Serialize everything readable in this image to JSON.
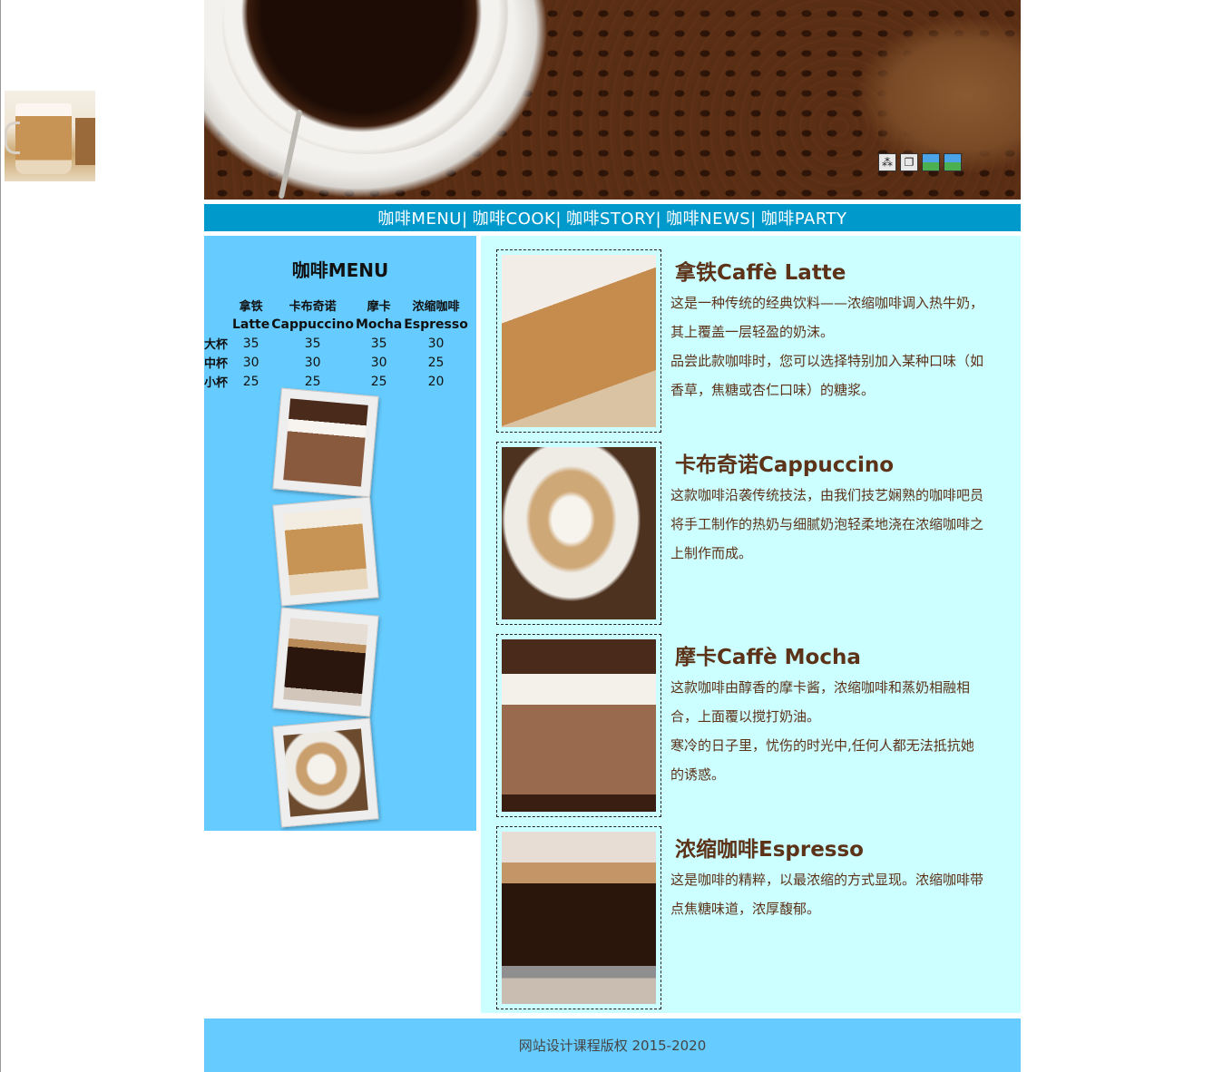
{
  "nav": {
    "text": "咖啡MENU| 咖啡COOK| 咖啡STORY| 咖啡NEWS| 咖啡PARTY",
    "items": [
      "咖啡MENU|",
      "咖啡COOK|",
      "咖啡STORY|",
      "咖啡NEWS|",
      "咖啡PARTY"
    ]
  },
  "sidebar": {
    "title": "咖啡MENU",
    "table": {
      "headers": [
        {
          "cn": "拿铁",
          "en": "Latte"
        },
        {
          "cn": "卡布奇诺",
          "en": "Cappuccino"
        },
        {
          "cn": "摩卡",
          "en": "Mocha"
        },
        {
          "cn": "浓缩咖啡",
          "en": "Espresso"
        }
      ],
      "rows": [
        {
          "size": "大杯",
          "prices": [
            "35",
            "35",
            "35",
            "30"
          ]
        },
        {
          "size": "中杯",
          "prices": [
            "30",
            "30",
            "30",
            "25"
          ]
        },
        {
          "size": "小杯",
          "prices": [
            "25",
            "25",
            "25",
            "20"
          ]
        }
      ]
    }
  },
  "items": [
    {
      "title": "拿铁Caffè Latte",
      "desc": [
        "这是一种传统的经典饮料——浓缩咖啡调入热牛奶，其上覆盖一层轻盈的奶沫。",
        "品尝此款咖啡时，您可以选择特别加入某种口味（如香草，焦糖或杏仁口味）的糖浆。"
      ]
    },
    {
      "title": "卡布奇诺Cappuccino",
      "desc": [
        "这款咖啡沿袭传统技法，由我们技艺娴熟的咖啡吧员将手工制作的热奶与细腻奶泡轻柔地浇在浓缩咖啡之上制作而成。"
      ]
    },
    {
      "title": "摩卡Caffè Mocha",
      "desc": [
        "这款咖啡由醇香的摩卡酱，浓缩咖啡和蒸奶相融相合，上面覆以搅打奶油。",
        "寒冷的日子里，忧伤的时光中,任何人都无法抵抗她的诱惑。"
      ]
    },
    {
      "title": "浓缩咖啡Espresso",
      "desc": [
        "这是咖啡的精粹，以最浓缩的方式显现。浓缩咖啡带点焦糖味道，浓厚馥郁。"
      ]
    }
  ],
  "footer": {
    "text": "网站设计课程版权 2015-2020"
  },
  "banner_icons": [
    "qr-icon",
    "window-icon",
    "image-icon",
    "picture-icon"
  ],
  "colors": {
    "nav": "#0099cc",
    "sidebar": "#66ccff",
    "main": "#ccffff",
    "text": "#5c3218"
  }
}
